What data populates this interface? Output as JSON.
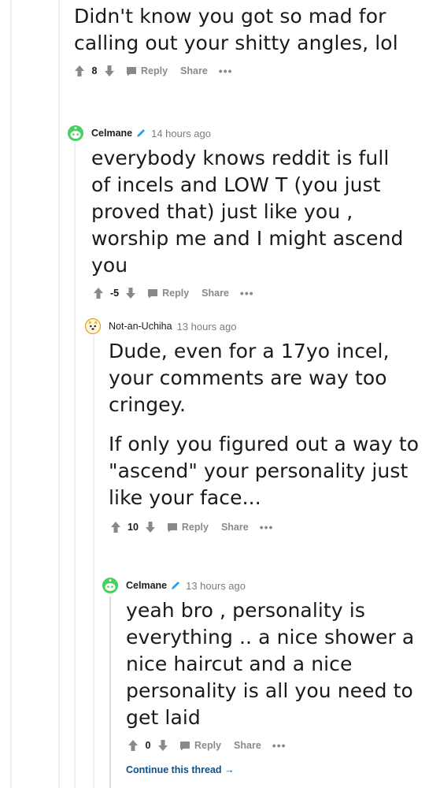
{
  "comments": [
    {
      "username": "",
      "time": "",
      "body": [
        "Didn't know you got so mad for calling out your shitty angles, lol"
      ],
      "score": "8",
      "reply_label": "Reply",
      "share_label": "Share",
      "more_label": "•••"
    },
    {
      "username": "Celmane",
      "time": "14 hours ago",
      "body": [
        "everybody knows reddit is full of incels and LOW T (you just proved that) just like you , worship me and I might ascend you"
      ],
      "score": "-5",
      "reply_label": "Reply",
      "share_label": "Share",
      "more_label": "•••"
    },
    {
      "username": "Not-an-Uchiha",
      "time": "13 hours ago",
      "body": [
        "Dude, even for a 17yo incel, your comments are way too cringey.",
        "If only you figured out a way to \"ascend\" your personality just like your face..."
      ],
      "score": "10",
      "reply_label": "Reply",
      "share_label": "Share",
      "more_label": "•••"
    },
    {
      "username": "Celmane",
      "time": "13 hours ago",
      "body": [
        "yeah bro , personality is everything .. a nice shower a nice haircut and a nice personality is all you need to get laid"
      ],
      "score": "0",
      "reply_label": "Reply",
      "share_label": "Share",
      "more_label": "•••"
    }
  ],
  "continue_thread": "Continue this thread",
  "continue_arrow": "→",
  "colors": {
    "text": "#1a1a1b",
    "meta": "#878a8c",
    "link": "#0f4f86",
    "thread_line": "#edeff1",
    "pencil": "#24a0ed",
    "snoo_green": "#46d160"
  },
  "icons": [
    "upvote-arrow-icon",
    "downvote-arrow-icon",
    "reply-bubble-icon",
    "edit-pencil-icon",
    "snoo-avatar-icon",
    "doge-avatar-icon"
  ]
}
